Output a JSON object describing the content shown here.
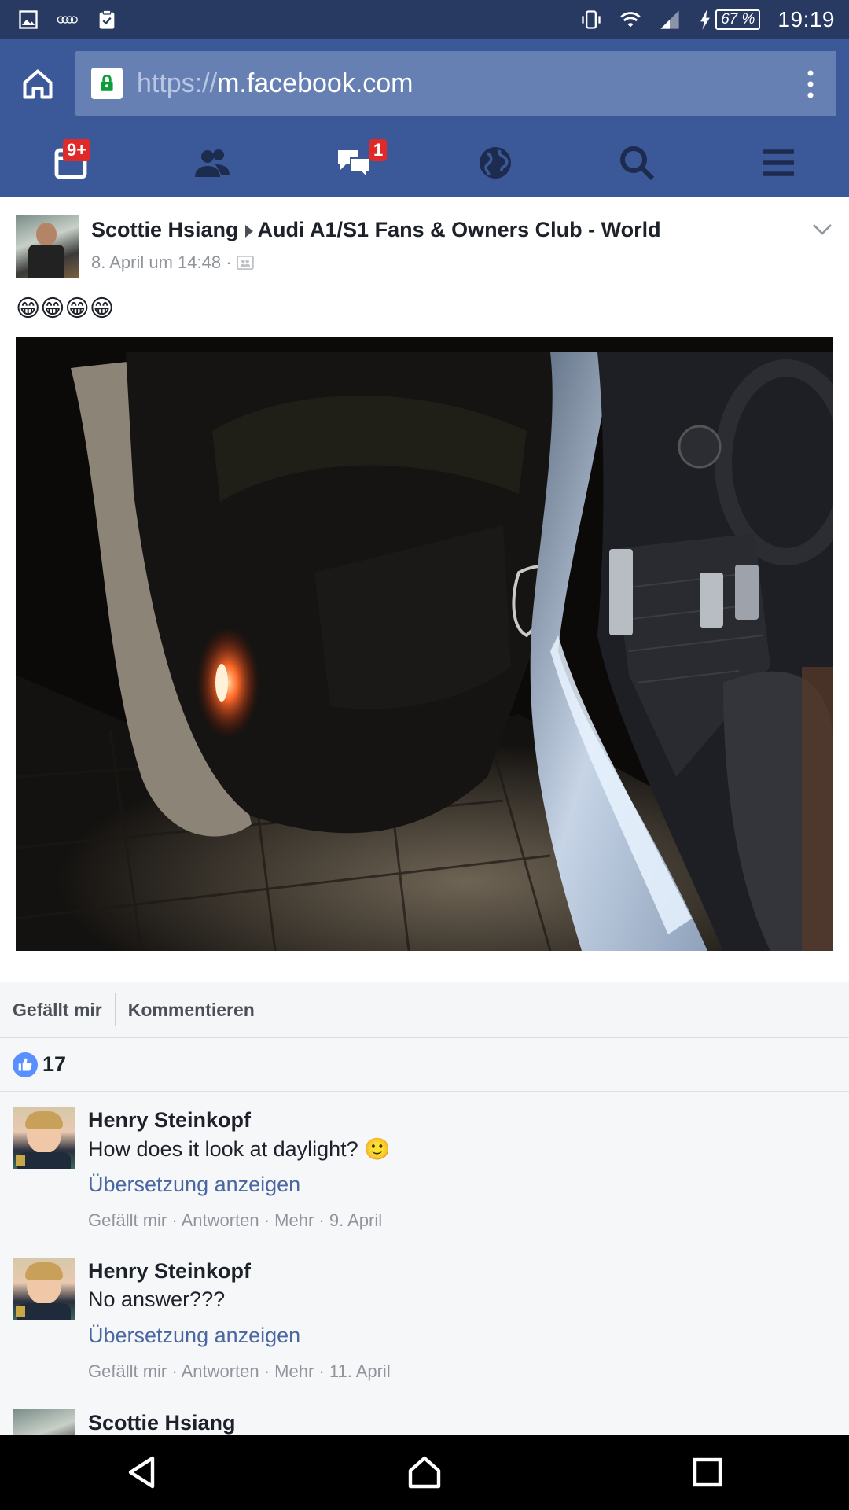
{
  "status_bar": {
    "battery": "67 %",
    "time": "19:19"
  },
  "browser": {
    "url_scheme": "https://",
    "url_host": "m.facebook.com"
  },
  "fb_nav": {
    "badges": {
      "friend_requests": "9+",
      "messages": "1"
    }
  },
  "post": {
    "author": "Scottie Hsiang",
    "group": "Audi A1/S1 Fans & Owners Club - World",
    "date": "8. April um 14:48 ·",
    "text": "😁😁😁😁"
  },
  "actions": {
    "like": "Gefällt mir",
    "comment": "Kommentieren"
  },
  "likes": {
    "count": "17"
  },
  "comments": [
    {
      "name": "Henry Steinkopf",
      "text": "How does it look at daylight? 🙂",
      "translate": "Übersetzung anzeigen",
      "meta": "Gefällt mir · Antworten · Mehr · 9. April"
    },
    {
      "name": "Henry Steinkopf",
      "text": "No answer???",
      "translate": "Übersetzung anzeigen",
      "meta": "Gefällt mir · Antworten · Mehr · 11. April"
    },
    {
      "name": "Scottie Hsiang"
    }
  ],
  "colors": {
    "fb_blue": "#3b5998",
    "status_bar": "#283a62",
    "link": "#4b67a1"
  }
}
